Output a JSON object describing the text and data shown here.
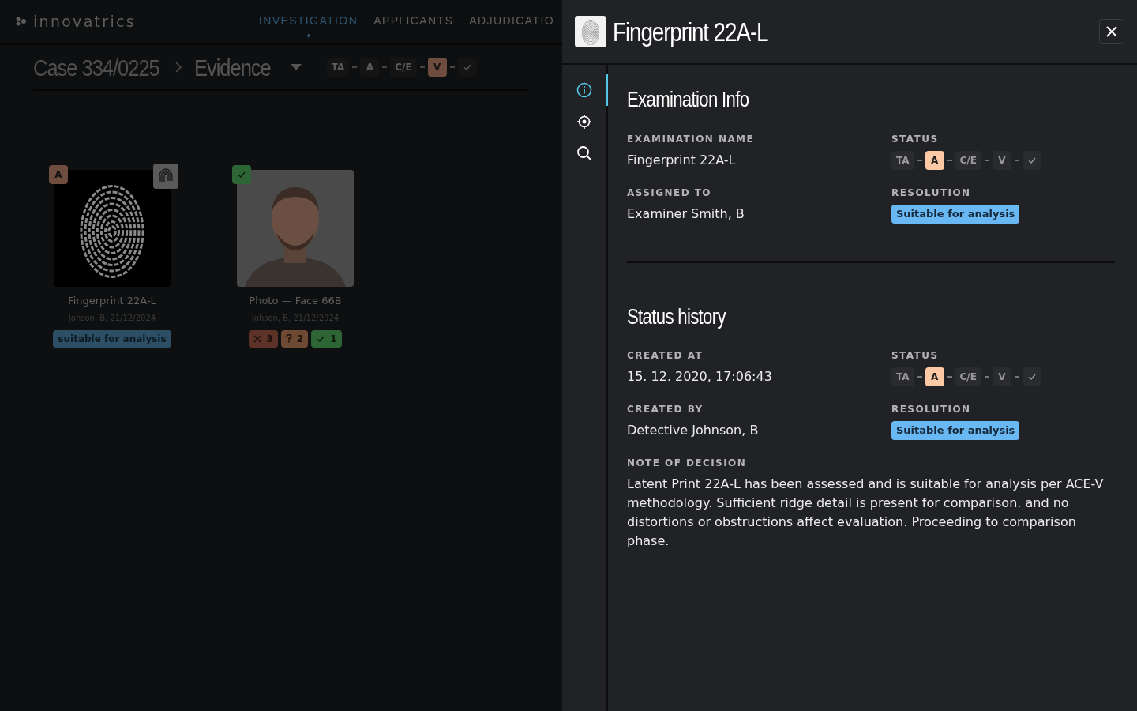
{
  "logo": {
    "name": "innovatrics"
  },
  "nav": [
    {
      "label": "INVESTIGATION",
      "selected": true
    },
    {
      "label": "APPLICANTS",
      "selected": false
    },
    {
      "label": "ADJUDICATIO",
      "selected": false
    }
  ],
  "breadcrumb": {
    "case": "Case 334/0225",
    "section": "Evidence"
  },
  "header_status": [
    {
      "kind": "text",
      "label": "TA",
      "selected": false
    },
    {
      "kind": "text",
      "label": "A",
      "selected": false
    },
    {
      "kind": "text",
      "label": "C/E",
      "selected": false
    },
    {
      "kind": "text",
      "label": "V",
      "selected": true
    },
    {
      "kind": "check",
      "selected": false
    }
  ],
  "cards": [
    {
      "kind": "fingerprint",
      "badge": {
        "kind": "text",
        "label": "A"
      },
      "title": "Fingerprint 22A-L",
      "meta": "Johson, B, 21/12/2024",
      "tags": [
        {
          "kind": "resolution",
          "label": "suitable for analysis"
        }
      ]
    },
    {
      "badge": {
        "kind": "check"
      },
      "title": "Photo — Face 66B",
      "meta": "Johson, B, 21/12/2024",
      "tags": [
        {
          "kind": "reject",
          "label": "3"
        },
        {
          "kind": "question",
          "label": "2"
        },
        {
          "kind": "accept",
          "label": "1"
        }
      ]
    }
  ],
  "drawer": {
    "title": "Fingerprint 22A-L",
    "side_tabs": [
      {
        "kind": "info",
        "selected": true
      },
      {
        "kind": "target",
        "selected": false
      },
      {
        "kind": "search",
        "selected": false
      }
    ],
    "sections": [
      {
        "title": "Examination Info",
        "fields": [
          {
            "kind": "text",
            "label": "EXAMINATION NAME",
            "value": "Fingerprint 22A-L"
          },
          {
            "kind": "status",
            "label": "STATUS",
            "steps": [
              {
                "kind": "text",
                "label": "TA",
                "selected": false
              },
              {
                "kind": "text",
                "label": "A",
                "selected": true
              },
              {
                "kind": "text",
                "label": "C/E",
                "selected": false
              },
              {
                "kind": "text",
                "label": "V",
                "selected": false
              },
              {
                "kind": "check",
                "selected": false
              }
            ]
          },
          {
            "kind": "text",
            "label": "ASSIGNED TO",
            "value": "Examiner Smith, B"
          },
          {
            "kind": "tag",
            "label": "RESOLUTION",
            "value": "Suitable for analysis"
          }
        ]
      },
      {
        "title": "Status history",
        "fields": [
          {
            "kind": "text",
            "label": "CREATED AT",
            "value": "15. 12. 2020, 17:06:43"
          },
          {
            "kind": "status",
            "label": "STATUS",
            "steps": [
              {
                "kind": "text",
                "label": "TA",
                "selected": false
              },
              {
                "kind": "text",
                "label": "A",
                "selected": true
              },
              {
                "kind": "text",
                "label": "C/E",
                "selected": false
              },
              {
                "kind": "text",
                "label": "V",
                "selected": false
              },
              {
                "kind": "check",
                "selected": false
              }
            ]
          },
          {
            "kind": "text",
            "label": "CREATED BY",
            "value": "Detective Johnson, B"
          },
          {
            "kind": "tag",
            "label": "RESOLUTION",
            "value": "Suitable for analysis"
          },
          {
            "kind": "note",
            "label": "NOTE OF DECISION",
            "value": "Latent Print 22A-L has been assessed and is suitable for analysis per ACE-V methodology. Sufficient ridge detail is present for comparison. and no distortions or obstructions affect evaluation. Proceeding to comparison phase."
          }
        ]
      }
    ]
  }
}
